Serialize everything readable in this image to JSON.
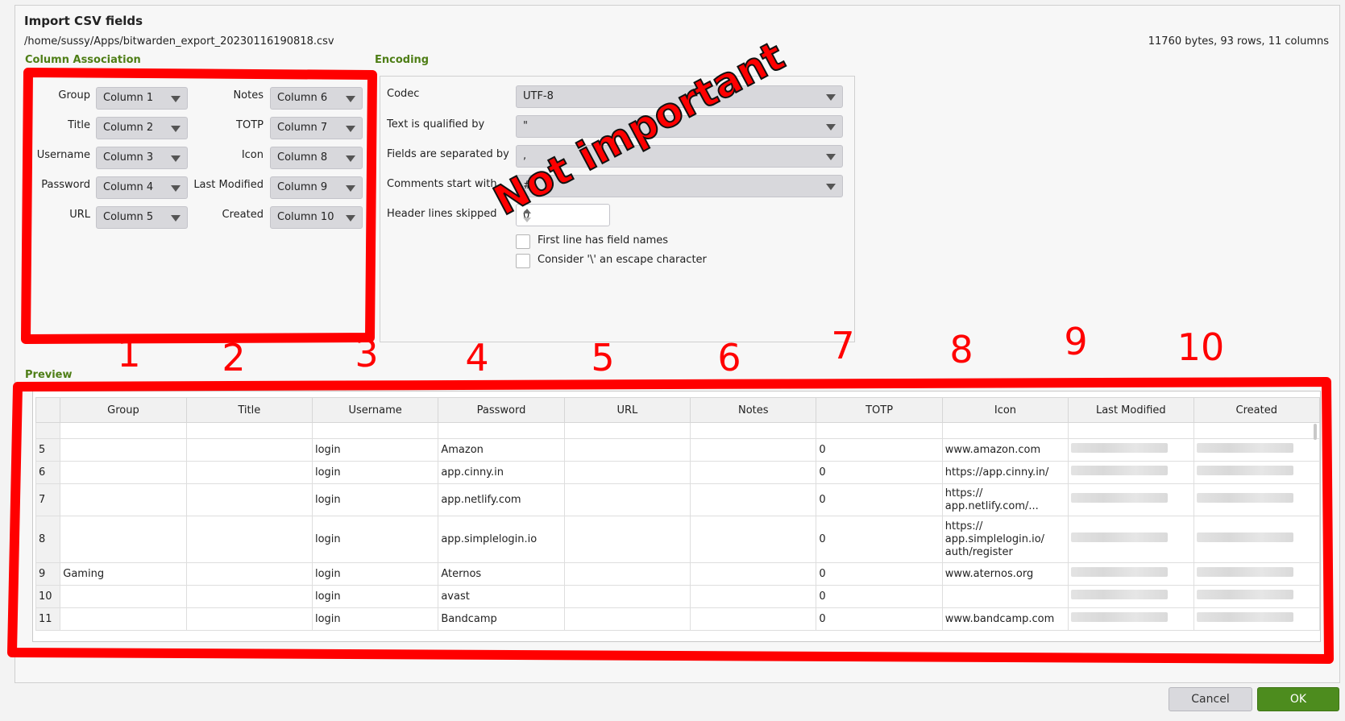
{
  "dialog": {
    "title": "Import CSV fields",
    "file_path": "/home/sussy/Apps/bitwarden_export_20230116190818.csv",
    "file_info": "11760 bytes, 93 rows, 11 columns"
  },
  "column_association": {
    "section_label": "Column Association",
    "left": [
      {
        "label": "Group",
        "value": "Column 1"
      },
      {
        "label": "Title",
        "value": "Column 2"
      },
      {
        "label": "Username",
        "value": "Column 3"
      },
      {
        "label": "Password",
        "value": "Column 4"
      },
      {
        "label": "URL",
        "value": "Column 5"
      }
    ],
    "right": [
      {
        "label": "Notes",
        "value": "Column 6"
      },
      {
        "label": "TOTP",
        "value": "Column 7"
      },
      {
        "label": "Icon",
        "value": "Column 8"
      },
      {
        "label": "Last Modified",
        "value": "Column 9"
      },
      {
        "label": "Created",
        "value": "Column 10"
      }
    ]
  },
  "encoding": {
    "section_label": "Encoding",
    "codec": {
      "label": "Codec",
      "value": "UTF-8"
    },
    "qualifier": {
      "label": "Text is qualified by",
      "value": "\""
    },
    "separator": {
      "label": "Fields are separated by",
      "value": ","
    },
    "comments": {
      "label": "Comments start with",
      "value": "#"
    },
    "header_skip": {
      "label": "Header lines skipped",
      "value": "0"
    },
    "first_line_names": {
      "label": "First line has field names",
      "checked": false
    },
    "escape_char": {
      "label": "Consider '\\' an escape character",
      "checked": false
    }
  },
  "preview": {
    "section_label": "Preview",
    "headers": [
      "Group",
      "Title",
      "Username",
      "Password",
      "URL",
      "Notes",
      "TOTP",
      "Icon",
      "Last Modified",
      "Created"
    ],
    "rows": [
      {
        "num": "5",
        "group": "",
        "title": "",
        "username": "login",
        "password": "Amazon",
        "url": "",
        "notes": "",
        "totp": "0",
        "icon": [
          "www.amazon.com"
        ]
      },
      {
        "num": "6",
        "group": "",
        "title": "",
        "username": "login",
        "password": "app.cinny.in",
        "url": "",
        "notes": "",
        "totp": "0",
        "icon": [
          "https://app.cinny.in/"
        ]
      },
      {
        "num": "7",
        "group": "",
        "title": "",
        "username": "login",
        "password": "app.netlify.com",
        "url": "",
        "notes": "",
        "totp": "0",
        "icon": [
          "https://",
          "app.netlify.com/..."
        ]
      },
      {
        "num": "8",
        "group": "",
        "title": "",
        "username": "login",
        "password": "app.simplelogin.io",
        "url": "",
        "notes": "",
        "totp": "0",
        "icon": [
          "https://",
          "app.simplelogin.io/",
          "auth/register"
        ]
      },
      {
        "num": "9",
        "group": "Gaming",
        "title": "",
        "username": "login",
        "password": "Aternos",
        "url": "",
        "notes": "",
        "totp": "0",
        "icon": [
          "www.aternos.org"
        ]
      },
      {
        "num": "10",
        "group": "",
        "title": "",
        "username": "login",
        "password": "avast",
        "url": "",
        "notes": "",
        "totp": "0",
        "icon": [
          ""
        ]
      },
      {
        "num": "11",
        "group": "",
        "title": "",
        "username": "login",
        "password": "Bandcamp",
        "url": "",
        "notes": "",
        "totp": "0",
        "icon": [
          "www.bandcamp.com"
        ]
      }
    ]
  },
  "buttons": {
    "cancel": "Cancel",
    "ok": "OK"
  },
  "annotations": {
    "column_numbers": [
      "1",
      "2",
      "3",
      "4",
      "5",
      "6",
      "7",
      "8",
      "9",
      "10"
    ],
    "stamp_text": "Not important",
    "color": "#ff0000"
  }
}
